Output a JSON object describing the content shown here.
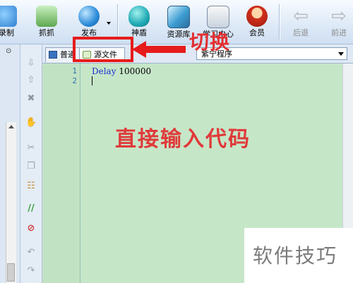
{
  "toolbar": {
    "record_label": "录制",
    "capture_label": "抓抓",
    "publish_label": "发布",
    "shendun_label": "神盾",
    "resource_label": "资源库",
    "learn_label": "学习中心",
    "member_label": "会员",
    "back_label": "后退",
    "forward_label": "前进"
  },
  "tabs": {
    "normal_label": "普通",
    "source_label": "源文件"
  },
  "combo": {
    "value": "紫宁程序"
  },
  "editor": {
    "line_numbers": [
      "1",
      "2"
    ],
    "line1_keyword": "Delay",
    "line1_arg": "100000"
  },
  "annotations": {
    "switch_text": "切换",
    "main_text": "直接输入代码",
    "accent_color": "#e61b1b"
  },
  "watermark": {
    "text": "软件技巧"
  }
}
